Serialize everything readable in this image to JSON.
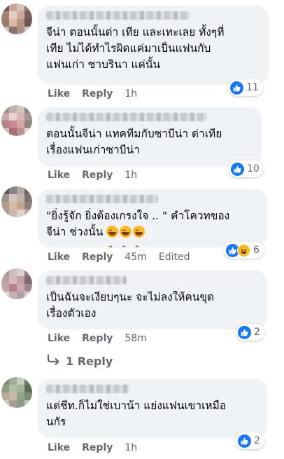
{
  "comments": [
    {
      "text": "จีน่า ตอนนั้นด่า เทีย และเทะเลย ทั้งๆที่\nเทีย ไม่ได้ทำไรผิดแค่มาเป็นแฟนกับ\nแฟนเก่า ซาบรินา แค่นั้น",
      "like": "Like",
      "reply": "Reply",
      "time": "1h",
      "edited": "",
      "reactions": [
        "like"
      ],
      "reaction_count": "11"
    },
    {
      "text": "ตอนนั้นจีน่า แทคทีมกับซาบีน่า ด่าเทีย\nเรื่องแฟนเก่าซาบีน่า",
      "like": "Like",
      "reply": "Reply",
      "time": "1h",
      "edited": "",
      "reactions": [
        "like"
      ],
      "reaction_count": "10"
    },
    {
      "text": "\"ยิ่งรู้จัก ยิ่งต้องเกรงใจ .. \" คำโควทของ\nจีน่า ช่วงนั้น",
      "emoji_count": 3,
      "emoji": "grinning-squinting-face",
      "like": "Like",
      "reply": "Reply",
      "time": "45m",
      "edited": "Edited",
      "reactions": [
        "like",
        "haha"
      ],
      "reaction_count": "6"
    },
    {
      "text": "เป็นฉันจะเงียบๆนะ จะไม่ลงให้คนขุด\nเรื่องตัวเอง",
      "like": "Like",
      "reply": "Reply",
      "time": "58m",
      "edited": "",
      "reactions": [
        "like"
      ],
      "reaction_count": "2"
    },
    {
      "text": "แต่ชีท.ก็ไม่ใช่เบาน้า แย่งแฟนเขาเหมือ\nนกัร",
      "like": "Like",
      "reply": "Reply",
      "time": "1h",
      "edited": "",
      "reactions": [
        "like"
      ],
      "reaction_count": "2"
    }
  ],
  "view_replies": {
    "label": "1 Reply",
    "icon": "reply-arrow-icon"
  },
  "colors": {
    "like_blue": "#1877f2",
    "bubble": "#f0f2f5",
    "meta": "#65676b",
    "haha_yellow": "#f7b928"
  }
}
